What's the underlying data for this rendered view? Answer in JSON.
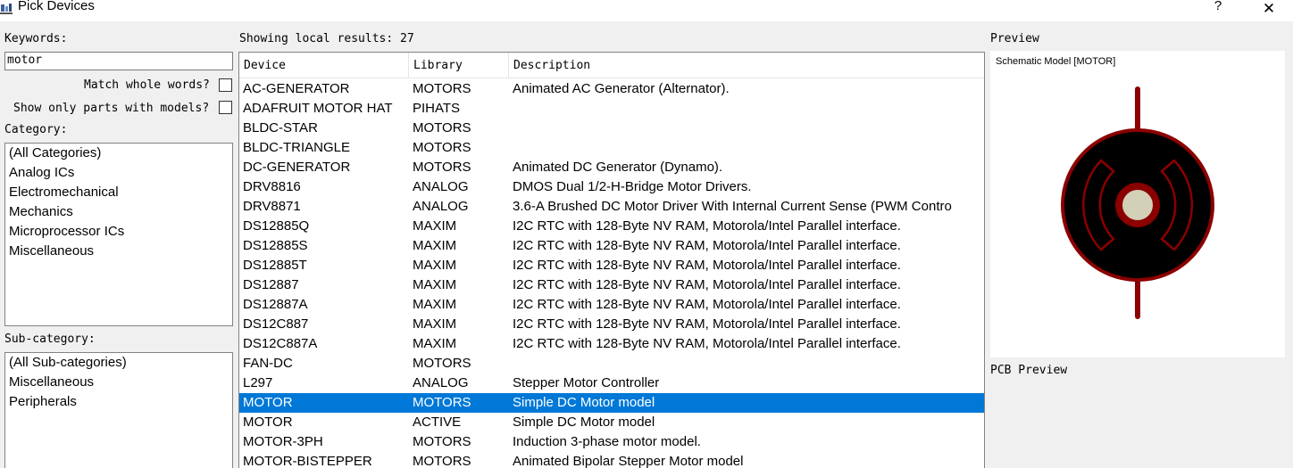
{
  "window": {
    "title": "Pick Devices",
    "help_glyph": "?",
    "close_glyph": "✕",
    "icon": "pick-devices-icon"
  },
  "keywords": {
    "label": "Keywords:",
    "value": "motor"
  },
  "options": {
    "match_whole_words_label": "Match whole words?",
    "match_whole_words_checked": false,
    "show_only_models_label": "Show only parts with models?",
    "show_only_models_checked": false
  },
  "category": {
    "label": "Category:",
    "items": [
      "(All Categories)",
      "Analog ICs",
      "Electromechanical",
      "Mechanics",
      "Microprocessor ICs",
      "Miscellaneous"
    ]
  },
  "subcategory": {
    "label": "Sub-category:",
    "items": [
      "(All Sub-categories)",
      "Miscellaneous",
      "Peripherals"
    ]
  },
  "results": {
    "status": "Showing local results: 27",
    "columns": [
      "Device",
      "Library",
      "Description"
    ],
    "rows": [
      {
        "device": "AC-GENERATOR",
        "library": "MOTORS",
        "description": "Animated AC Generator (Alternator)."
      },
      {
        "device": "ADAFRUIT MOTOR HAT",
        "library": "PIHATS",
        "description": ""
      },
      {
        "device": "BLDC-STAR",
        "library": "MOTORS",
        "description": ""
      },
      {
        "device": "BLDC-TRIANGLE",
        "library": "MOTORS",
        "description": ""
      },
      {
        "device": "DC-GENERATOR",
        "library": "MOTORS",
        "description": "Animated DC Generator (Dynamo)."
      },
      {
        "device": "DRV8816",
        "library": "ANALOG",
        "description": "DMOS Dual 1/2-H-Bridge Motor Drivers."
      },
      {
        "device": "DRV8871",
        "library": "ANALOG",
        "description": "3.6-A Brushed DC Motor Driver With Internal Current Sense (PWM Contro"
      },
      {
        "device": "DS12885Q",
        "library": "MAXIM",
        "description": "I2C RTC with 128-Byte NV RAM, Motorola/Intel Parallel interface."
      },
      {
        "device": "DS12885S",
        "library": "MAXIM",
        "description": "I2C RTC with 128-Byte NV RAM, Motorola/Intel Parallel interface."
      },
      {
        "device": "DS12885T",
        "library": "MAXIM",
        "description": "I2C RTC with 128-Byte NV RAM, Motorola/Intel Parallel interface."
      },
      {
        "device": "DS12887",
        "library": "MAXIM",
        "description": "I2C RTC with 128-Byte NV RAM, Motorola/Intel Parallel interface."
      },
      {
        "device": "DS12887A",
        "library": "MAXIM",
        "description": "I2C RTC with 128-Byte NV RAM, Motorola/Intel Parallel interface."
      },
      {
        "device": "DS12C887",
        "library": "MAXIM",
        "description": "I2C RTC with 128-Byte NV RAM, Motorola/Intel Parallel interface."
      },
      {
        "device": "DS12C887A",
        "library": "MAXIM",
        "description": "I2C RTC with 128-Byte NV RAM, Motorola/Intel Parallel interface."
      },
      {
        "device": "FAN-DC",
        "library": "MOTORS",
        "description": ""
      },
      {
        "device": "L297",
        "library": "ANALOG",
        "description": "Stepper Motor Controller"
      },
      {
        "device": "MOTOR",
        "library": "MOTORS",
        "description": "Simple DC Motor model",
        "selected": true
      },
      {
        "device": "MOTOR",
        "library": "ACTIVE",
        "description": "Simple DC Motor model"
      },
      {
        "device": "MOTOR-3PH",
        "library": "MOTORS",
        "description": "Induction 3-phase motor model."
      },
      {
        "device": "MOTOR-BISTEPPER",
        "library": "MOTORS",
        "description": "Animated Bipolar Stepper Motor model"
      }
    ]
  },
  "preview": {
    "label": "Preview",
    "caption": "Schematic Model [MOTOR]",
    "pcb_label": "PCB Preview",
    "symbol_icon": "motor-symbol-icon"
  },
  "colors": {
    "selection": "#0078d7",
    "symbol_outline": "#8b0000",
    "symbol_fill": "#000000",
    "shaft_fill": "#d3d0b8"
  }
}
